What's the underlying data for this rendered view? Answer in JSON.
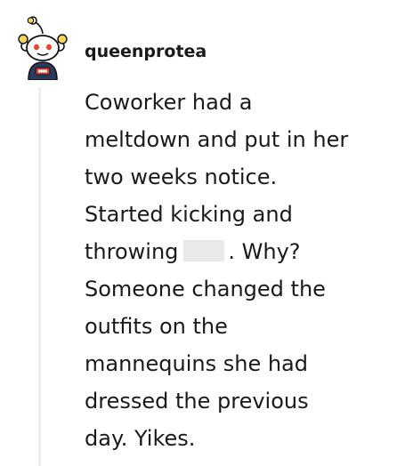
{
  "comment": {
    "author": {
      "username": "queenprotea",
      "avatar_icon": "snoo-avatar-icon"
    },
    "body_lines": [
      "Coworker had a",
      "meltdown and put in her",
      "two weeks notice.",
      "Started kicking and",
      "throwing",
      ". Why?",
      "Someone changed the",
      "outfits on the",
      "mannequins she had",
      "dressed the previous",
      "day. Yikes."
    ]
  },
  "colors": {
    "text": "#1a1a1b",
    "thread_line": "#edeff1",
    "redaction": "#e9e9ea",
    "avatar_shirt": "#2a3a5e",
    "avatar_badge": "#d93a32"
  }
}
